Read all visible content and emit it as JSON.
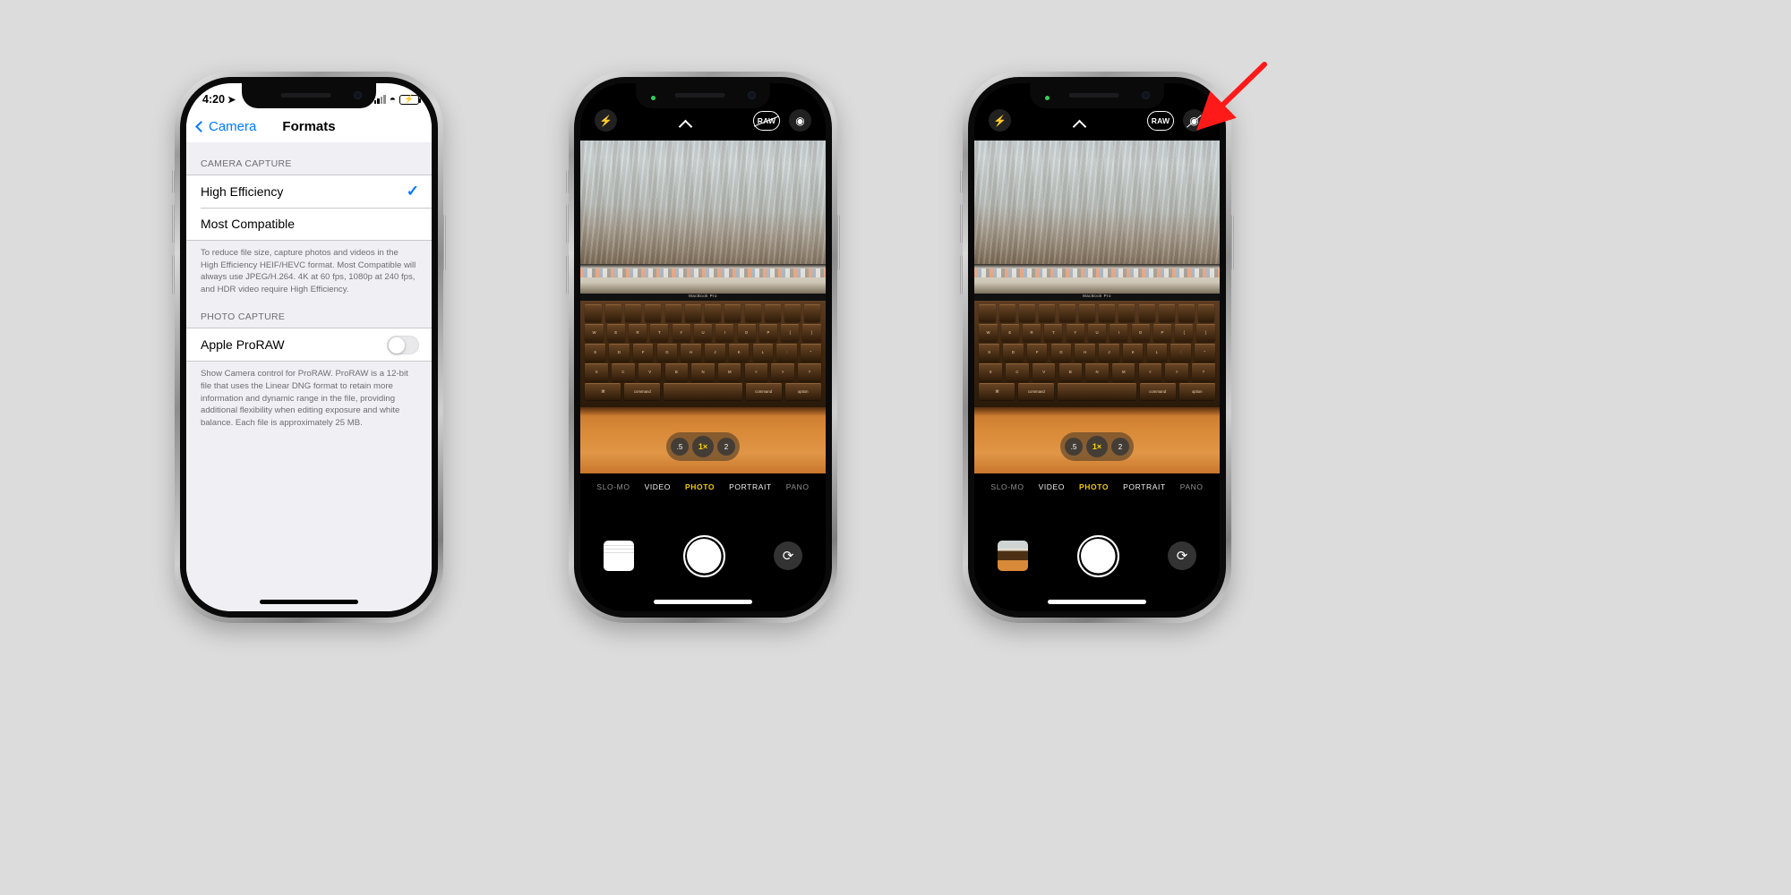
{
  "meta": {
    "background_color": "#dcdcdc",
    "accent_blue": "#007aff",
    "accent_yellow": "#ffd60a",
    "annotation_arrow_color": "#ff1a1a"
  },
  "phone1": {
    "status_bar": {
      "time": "4:20",
      "location_icon": "location-arrow-icon",
      "signal_icon": "cellular-signal-icon",
      "wifi_icon": "wifi-icon",
      "battery_icon": "battery-charging-icon",
      "battery_bolt": "⚡"
    },
    "nav": {
      "back_label": "Camera",
      "back_icon": "chevron-left-icon",
      "title": "Formats"
    },
    "sections": [
      {
        "header": "CAMERA CAPTURE",
        "rows": [
          {
            "label": "High Efficiency",
            "checked": true,
            "check_glyph": "✓"
          },
          {
            "label": "Most Compatible",
            "checked": false,
            "check_glyph": ""
          }
        ],
        "footnote": "To reduce file size, capture photos and videos in the High Efficiency HEIF/HEVC format. Most Compatible will always use JPEG/H.264. 4K at 60 fps, 1080p at 240 fps, and HDR video require High Efficiency."
      },
      {
        "header": "PHOTO CAPTURE",
        "toggle_row": {
          "label": "Apple ProRAW",
          "on": false
        },
        "footnote": "Show Camera control for ProRAW. ProRAW is a 12-bit file that uses the Linear DNG format to retain more information and dynamic range in the file, providing additional flexibility when editing exposure and white balance. Each file is approximately 25 MB."
      }
    ]
  },
  "phone2": {
    "top_controls": {
      "flash_icon": "flash-bolt-icon",
      "flash_glyph": "⚡",
      "chevron_icon": "chevron-up-icon",
      "raw_label": "RAW",
      "raw_enabled": true,
      "raw_slashed": true,
      "live_photo_icon": "live-photo-icon"
    },
    "zoom_options": [
      {
        "label": ".5",
        "active": false
      },
      {
        "label": "1×",
        "active": true
      },
      {
        "label": "2",
        "active": false
      }
    ],
    "modes": [
      {
        "label": "SLO-MO",
        "active": false,
        "edge": true
      },
      {
        "label": "VIDEO",
        "active": false,
        "edge": false
      },
      {
        "label": "PHOTO",
        "active": true,
        "edge": false
      },
      {
        "label": "PORTRAIT",
        "active": false,
        "edge": false
      },
      {
        "label": "PANO",
        "active": false,
        "edge": true
      }
    ],
    "shutter": {
      "thumbnail_name": "last-photo-thumbnail",
      "shutter_name": "shutter-button",
      "flip_icon": "camera-flip-icon",
      "flip_glyph": "⟳"
    },
    "viewfinder_label": "MacBook Pro"
  },
  "phone3": {
    "top_controls": {
      "flash_icon": "flash-bolt-icon",
      "flash_glyph": "⚡",
      "chevron_icon": "chevron-up-icon",
      "raw_label": "RAW",
      "raw_enabled": true,
      "raw_slashed": false,
      "live_photo_icon": "live-photo-off-icon"
    },
    "zoom_options": [
      {
        "label": ".5",
        "active": false
      },
      {
        "label": "1×",
        "active": true
      },
      {
        "label": "2",
        "active": false
      }
    ],
    "modes": [
      {
        "label": "SLO-MO",
        "active": false,
        "edge": true
      },
      {
        "label": "VIDEO",
        "active": false,
        "edge": false
      },
      {
        "label": "PHOTO",
        "active": true,
        "edge": false
      },
      {
        "label": "PORTRAIT",
        "active": false,
        "edge": false
      },
      {
        "label": "PANO",
        "active": false,
        "edge": true
      }
    ],
    "shutter": {
      "thumbnail_name": "last-photo-thumbnail",
      "shutter_name": "shutter-button",
      "flip_icon": "camera-flip-icon",
      "flip_glyph": "⟳"
    },
    "viewfinder_label": "MacBook Pro"
  },
  "keyboard_rows": [
    [
      "",
      "",
      "",
      "",
      "",
      "",
      "",
      "",
      "",
      "",
      "",
      ""
    ],
    [
      "W",
      "E",
      "R",
      "T",
      "Y",
      "U",
      "I",
      "O",
      "P",
      "{",
      "}"
    ],
    [
      "S",
      "D",
      "F",
      "G",
      "H",
      "J",
      "K",
      "L",
      ":",
      "\""
    ],
    [
      "X",
      "C",
      "V",
      "B",
      "N",
      "M",
      "<",
      ">",
      "?"
    ],
    [
      "⌘",
      "command",
      "",
      "command",
      "option"
    ]
  ]
}
